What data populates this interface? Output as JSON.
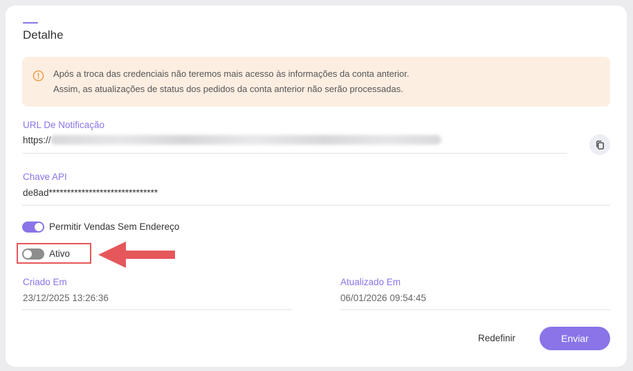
{
  "detail": {
    "title": "Detalhe"
  },
  "alert": {
    "icon": "warning-circle-icon",
    "lines": [
      "Após a troca das credenciais não teremos mais acesso às informações da conta anterior.",
      "Assim, as atualizações de status dos pedidos da conta anterior não serão processadas."
    ]
  },
  "fields": {
    "notification_url": {
      "label": "URL De Notificação",
      "value_prefix": "https://"
    },
    "api_key": {
      "label": "Chave API",
      "value": "de8ad******************************"
    },
    "created_at": {
      "label": "Criado Em",
      "value": "23/12/2025 13:26:36"
    },
    "updated_at": {
      "label": "Atualizado Em",
      "value": "06/01/2026 09:54:45"
    }
  },
  "toggles": {
    "allow_no_address": {
      "label": "Permitir Vendas Sem Endereço",
      "state": "on"
    },
    "active": {
      "label": "Ativo",
      "state": "off"
    }
  },
  "buttons": {
    "reset": "Redefinir",
    "submit": "Enviar"
  },
  "colors": {
    "accent": "#8a74e8",
    "alert_bg": "#fdeee2",
    "alert_icon": "#e69a3c",
    "annotation_red": "#e5575a"
  }
}
